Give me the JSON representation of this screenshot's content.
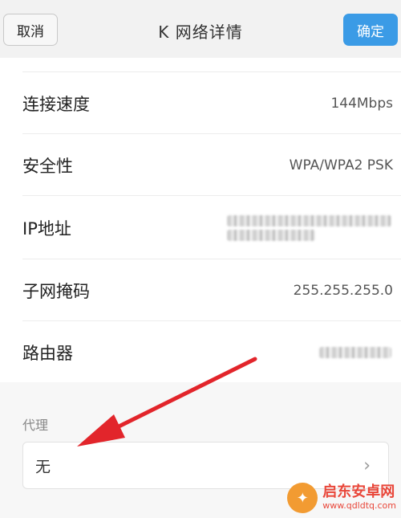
{
  "header": {
    "cancel_label": "取消",
    "title": "K  网络详情",
    "ok_label": "确定",
    "accent": "#3b9be6"
  },
  "rows": [
    {
      "label": "连接速度",
      "value": "144Mbps"
    },
    {
      "label": "安全性",
      "value": "WPA/WPA2 PSK"
    },
    {
      "label": "IP地址",
      "value": ""
    },
    {
      "label": "子网掩码",
      "value": "255.255.255.0"
    },
    {
      "label": "路由器",
      "value": ""
    }
  ],
  "proxy": {
    "section_label": "代理",
    "value": "无",
    "chevron_icon": "chevron-right-icon"
  },
  "annotation": {
    "arrow_color": "#e2252b"
  },
  "watermark": {
    "title": "启东安卓网",
    "url": "www.qdldtq.com"
  }
}
